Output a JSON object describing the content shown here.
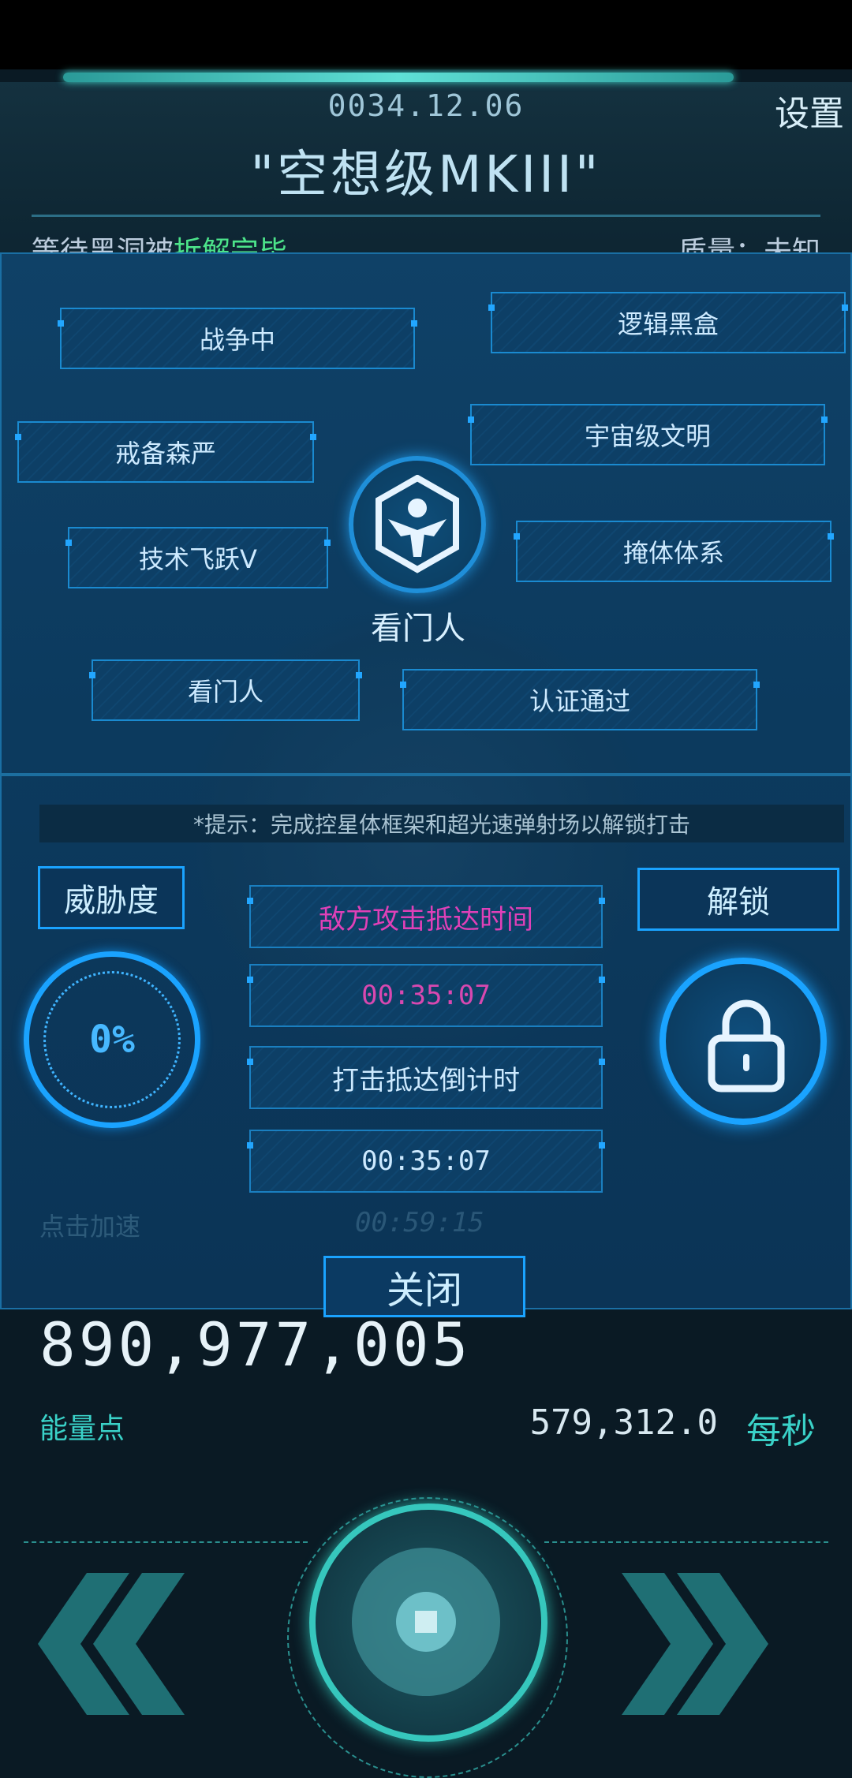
{
  "header": {
    "date": "0034.12.06",
    "settings_label": "设置",
    "title": "\"空想级MKIII\"",
    "status_left_prefix": "等待黑洞被",
    "status_left_highlight": "拆解完毕",
    "status_right": "质量：未知"
  },
  "panel": {
    "tags": [
      "战争中",
      "逻辑黑盒",
      "戒备森严",
      "宇宙级文明",
      "技术飞跃V",
      "掩体体系",
      "看门人",
      "认证通过"
    ],
    "emblem_label": "看门人",
    "emblem_icon": "gatekeeper-emblem-icon",
    "hint": "*提示：完成控星体框架和超光速弹射场以解锁打击",
    "threat_label": "威胁度",
    "threat_value": "0%",
    "unlock_label": "解锁",
    "lock_icon": "lock-icon",
    "enemy_attack_label": "敌方攻击抵达时间",
    "enemy_attack_time": "00:35:07",
    "strike_countdown_label": "打击抵达倒计时",
    "strike_countdown_time": "00:35:07",
    "faded_accelerate": "点击加速",
    "faded_timer": "00:59:15",
    "close_label": "关闭"
  },
  "resources": {
    "energy_points": "890,977,005",
    "energy_label": "能量点",
    "rate_value": "579,312.0",
    "rate_unit": "每秒"
  },
  "colors": {
    "accent_blue": "#1aa3ff",
    "accent_teal": "#36c7bd",
    "timer_magenta": "#e040b8",
    "status_green": "#4ce38a"
  }
}
